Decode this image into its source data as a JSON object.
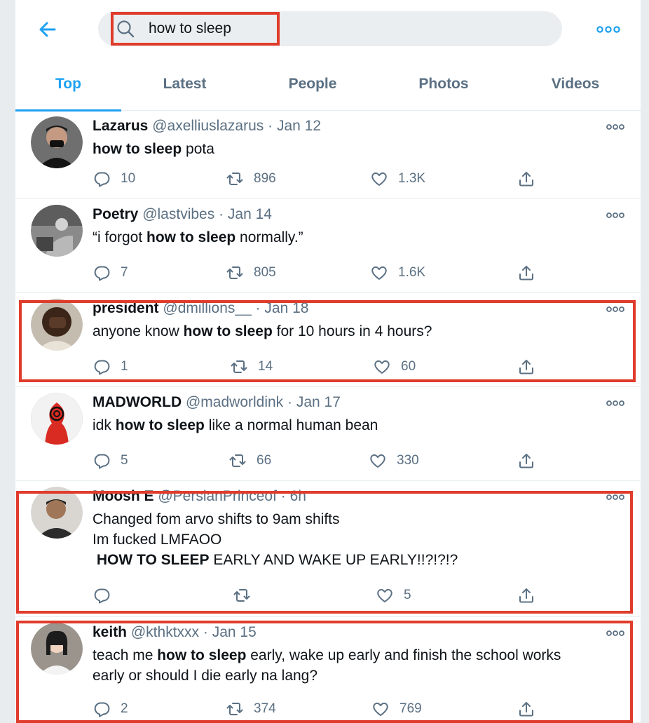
{
  "search": {
    "query": "how to sleep"
  },
  "tabs": [
    {
      "label": "Top",
      "active": true
    },
    {
      "label": "Latest",
      "active": false
    },
    {
      "label": "People",
      "active": false
    },
    {
      "label": "Photos",
      "active": false
    },
    {
      "label": "Videos",
      "active": false
    }
  ],
  "tweets": [
    {
      "name": "Lazarus",
      "handle": "@axelliuslazarus",
      "date": "Jan 12",
      "text_parts": [
        {
          "t": "how to sleep",
          "b": true
        },
        {
          "t": " pota",
          "b": false
        }
      ],
      "replies": "10",
      "retweets": "896",
      "likes": "1.3K",
      "highlighted": false
    },
    {
      "name": "Poetry",
      "handle": "@lastvibes",
      "date": "Jan 14",
      "text_parts": [
        {
          "t": "“i forgot ",
          "b": false
        },
        {
          "t": "how to sleep",
          "b": true
        },
        {
          "t": " normally.”",
          "b": false
        }
      ],
      "replies": "7",
      "retweets": "805",
      "likes": "1.6K",
      "highlighted": false
    },
    {
      "name": "president",
      "handle": "@dmillions__",
      "date": "Jan 18",
      "text_parts": [
        {
          "t": "anyone know ",
          "b": false
        },
        {
          "t": "how to sleep",
          "b": true
        },
        {
          "t": " for 10 hours in 4 hours?",
          "b": false
        }
      ],
      "replies": "1",
      "retweets": "14",
      "likes": "60",
      "highlighted": true
    },
    {
      "name": "MADWORLD",
      "handle": "@madworldink",
      "date": "Jan 17",
      "text_parts": [
        {
          "t": "idk ",
          "b": false
        },
        {
          "t": "how to sleep",
          "b": true
        },
        {
          "t": " like a normal human bean",
          "b": false
        }
      ],
      "replies": "5",
      "retweets": "66",
      "likes": "330",
      "highlighted": false
    },
    {
      "name": "Moosh E",
      "handle": "@PersianPrinceof",
      "date": "6h",
      "text_parts": [
        {
          "t": "Changed fom arvo shifts to 9am shifts\nIm fucked LMFAOO\n ",
          "b": false
        },
        {
          "t": "HOW TO SLEEP",
          "b": true
        },
        {
          "t": " EARLY AND WAKE UP EARLY!!?!?!?",
          "b": false
        }
      ],
      "replies": "",
      "retweets": "",
      "likes": "5",
      "highlighted": true
    },
    {
      "name": "keith",
      "handle": "@kthktxxx",
      "date": "Jan 15",
      "text_parts": [
        {
          "t": "teach me ",
          "b": false
        },
        {
          "t": "how to sleep",
          "b": true
        },
        {
          "t": " early, wake up early and finish the school works\nearly or should I die early na lang?",
          "b": false
        }
      ],
      "replies": "2",
      "retweets": "374",
      "likes": "769",
      "highlighted": true
    }
  ],
  "colors": {
    "accent": "#1da1f2",
    "secondary_text": "#5b7083",
    "annotation": "#e03c2c"
  },
  "icons": {
    "back": "arrow-left-icon",
    "search": "search-icon",
    "more": "more-icon",
    "reply": "reply-icon",
    "retweet": "retweet-icon",
    "like": "heart-icon",
    "share": "share-icon"
  }
}
